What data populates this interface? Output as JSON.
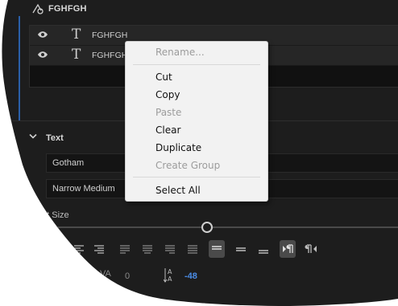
{
  "header": {
    "title": "FGHFGH",
    "icon": "layer-shape-icon"
  },
  "layers": [
    {
      "name": "FGHFGH",
      "visible_icon": "eye-icon",
      "type_icon": "text-layer-icon",
      "glyph": "T"
    },
    {
      "name": "FGHFGH",
      "visible_icon": "eye-icon",
      "type_icon": "text-layer-icon",
      "glyph": "T"
    }
  ],
  "text_section": {
    "title": "Text",
    "font_family": "Gotham",
    "font_style": "Narrow Medium",
    "font_size_label": "nt Size",
    "kerning_value": "0",
    "tracking_value": "-48",
    "kerning_label": "VA"
  },
  "context_menu": {
    "items": [
      {
        "label": "Rename...",
        "enabled": false
      },
      {
        "label": "Cut",
        "enabled": true
      },
      {
        "label": "Copy",
        "enabled": true
      },
      {
        "label": "Paste",
        "enabled": false
      },
      {
        "label": "Clear",
        "enabled": true
      },
      {
        "label": "Duplicate",
        "enabled": true
      },
      {
        "label": "Create Group",
        "enabled": false
      },
      {
        "label": "Select All",
        "enabled": true
      }
    ]
  },
  "colors": {
    "panel_bg": "#1d1d1d",
    "accent_blue": "#4b8de8",
    "menu_bg": "#f2f2f2"
  }
}
